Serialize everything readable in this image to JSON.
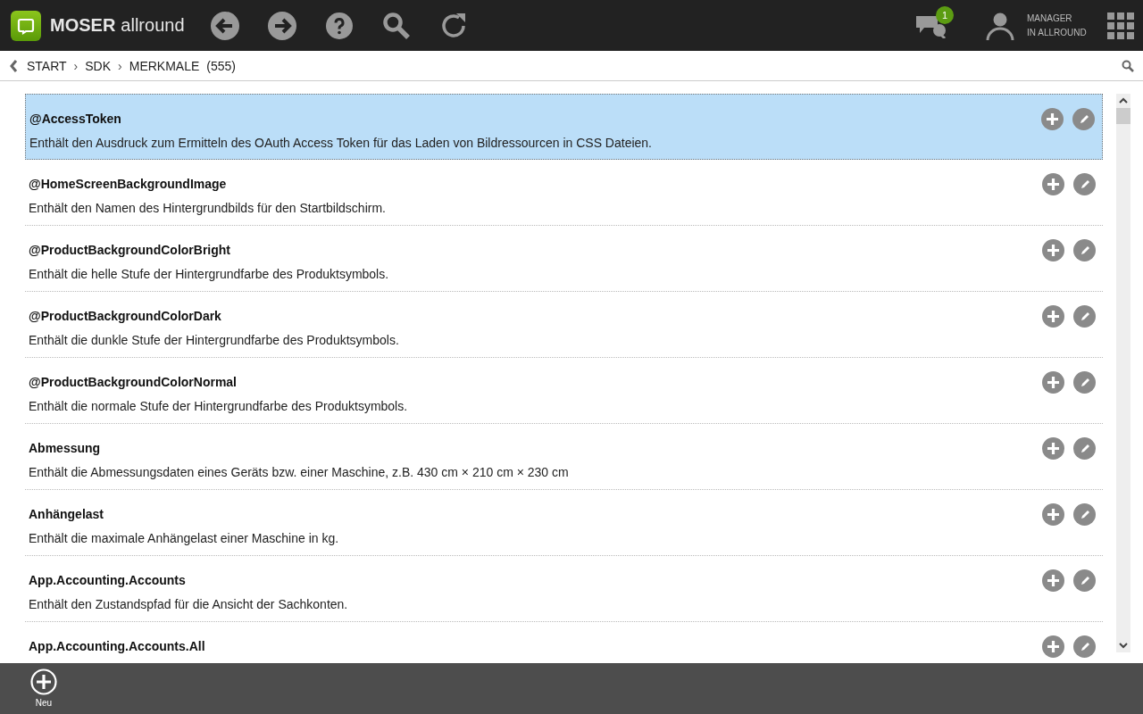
{
  "header": {
    "brand": "MOSER",
    "product": "allround",
    "notifications": "1",
    "user_lines": [
      "MANAGER",
      "IN ALLROUND"
    ]
  },
  "breadcrumb": {
    "items": [
      "START",
      "SDK",
      "MERKMALE"
    ],
    "separator": "›",
    "count": "(555)"
  },
  "items": [
    {
      "title": "@AccessToken",
      "description": "Enthält den Ausdruck zum Ermitteln des OAuth Access Token für das Laden von Bildressourcen in CSS Dateien.",
      "selected": true
    },
    {
      "title": "@HomeScreenBackgroundImage",
      "description": "Enthält den Namen des Hintergrundbilds für den Startbildschirm.",
      "selected": false
    },
    {
      "title": "@ProductBackgroundColorBright",
      "description": "Enthält die helle Stufe der Hintergrundfarbe des Produktsymbols.",
      "selected": false
    },
    {
      "title": "@ProductBackgroundColorDark",
      "description": "Enthält die dunkle Stufe der Hintergrundfarbe des Produktsymbols.",
      "selected": false
    },
    {
      "title": "@ProductBackgroundColorNormal",
      "description": "Enthält die normale Stufe der Hintergrundfarbe des Produktsymbols.",
      "selected": false
    },
    {
      "title": "Abmessung",
      "description": "Enthält die Abmessungsdaten eines Geräts bzw. einer Maschine, z.B. 430 cm × 210 cm × 230 cm",
      "selected": false
    },
    {
      "title": "Anhängelast",
      "description": "Enthält die maximale Anhängelast einer Maschine in kg.",
      "selected": false
    },
    {
      "title": "App.Accounting.Accounts",
      "description": "Enthält den Zustandspfad für die Ansicht der Sachkonten.",
      "selected": false
    },
    {
      "title": "App.Accounting.Accounts.All",
      "selected": false
    }
  ],
  "footer": {
    "actions": [
      {
        "label": "Neu"
      }
    ]
  }
}
